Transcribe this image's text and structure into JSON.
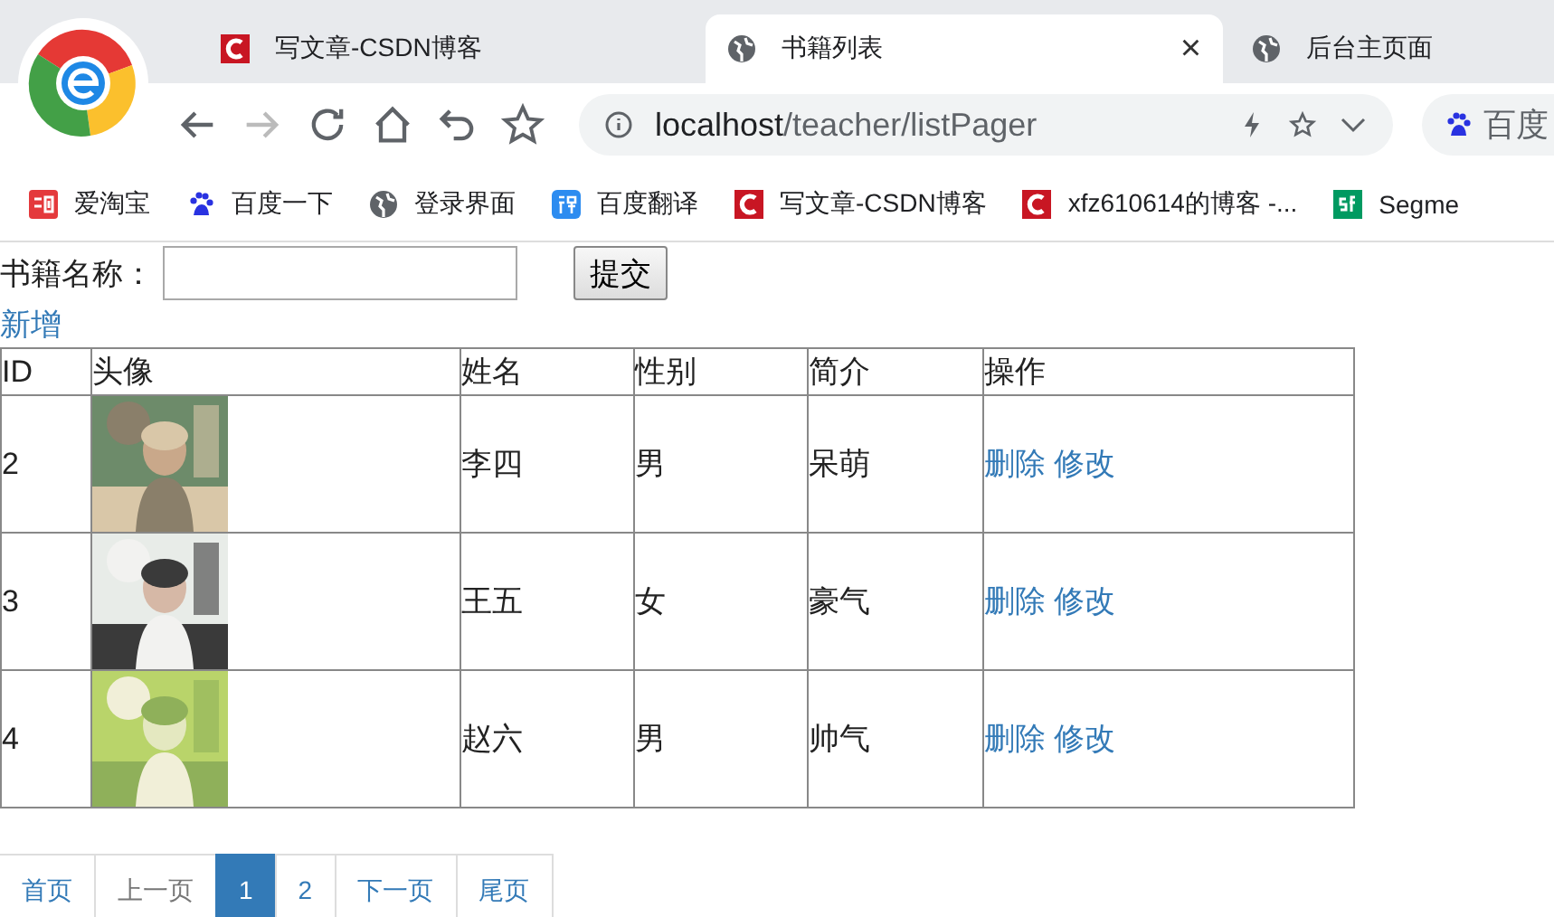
{
  "browser": {
    "tabs": [
      {
        "title": "写文章-CSDN博客",
        "kind": "csdn",
        "selected": false,
        "closable": false
      },
      {
        "title": "书籍列表",
        "kind": "globe",
        "selected": true,
        "closable": true
      },
      {
        "title": "后台主页面",
        "kind": "globe",
        "selected": false,
        "closable": false
      }
    ],
    "close_glyph": "×",
    "address": {
      "host": "localhost",
      "path": "/teacher/listPager"
    },
    "search_box": {
      "kind": "baidu",
      "text": "百度"
    },
    "bookmarks": [
      {
        "label": "爱淘宝",
        "kind": "taobao"
      },
      {
        "label": "百度一下",
        "kind": "baidu"
      },
      {
        "label": "登录界面",
        "kind": "globe"
      },
      {
        "label": "百度翻译",
        "kind": "translate"
      },
      {
        "label": "写文章-CSDN博客",
        "kind": "csdn"
      },
      {
        "label": "xfz610614的博客 -...",
        "kind": "csdn"
      },
      {
        "label": "Segme",
        "kind": "sf"
      }
    ]
  },
  "page": {
    "search": {
      "label": "书籍名称：",
      "button": "提交"
    },
    "add_link": "新增",
    "table": {
      "columns": [
        "ID",
        "头像",
        "姓名",
        "性别",
        "简介",
        "操作"
      ],
      "rows": [
        {
          "id": "2",
          "avatar": {
            "kind": "picture"
          },
          "name": "李四",
          "gender": "男",
          "bio": "呆萌",
          "actions": [
            "删除",
            "修改"
          ]
        },
        {
          "id": "3",
          "avatar": {
            "kind": "picture"
          },
          "name": "王五",
          "gender": "女",
          "bio": "豪气",
          "actions": [
            "删除",
            "修改"
          ]
        },
        {
          "id": "4",
          "avatar": {
            "kind": "picture"
          },
          "name": "赵六",
          "gender": "男",
          "bio": "帅气",
          "actions": [
            "删除",
            "修改"
          ]
        }
      ]
    },
    "pagination": [
      {
        "label": "首页",
        "selected": false,
        "disabled": false
      },
      {
        "label": "上一页",
        "selected": false,
        "disabled": true
      },
      {
        "label": "1",
        "selected": true,
        "disabled": false
      },
      {
        "label": "2",
        "selected": false,
        "disabled": false
      },
      {
        "label": "下一页",
        "selected": false,
        "disabled": false
      },
      {
        "label": "尾页",
        "selected": false,
        "disabled": false
      }
    ]
  }
}
